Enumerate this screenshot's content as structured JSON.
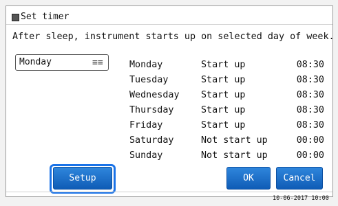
{
  "window": {
    "title": "Set timer",
    "icon": "timer-window-icon"
  },
  "instructions": "After sleep, instrument starts up on selected day of week.",
  "day_select": {
    "value": "Monday",
    "icon": "menu-lines-icon",
    "icon_glyph": "≡≡"
  },
  "schedule": [
    {
      "day": "Monday",
      "status": "Start up",
      "time": "08:30"
    },
    {
      "day": "Tuesday",
      "status": "Start up",
      "time": "08:30"
    },
    {
      "day": "Wednesday",
      "status": "Start up",
      "time": "08:30"
    },
    {
      "day": "Thursday",
      "status": "Start up",
      "time": "08:30"
    },
    {
      "day": "Friday",
      "status": "Start up",
      "time": "08:30"
    },
    {
      "day": "Saturday",
      "status": "Not start up",
      "time": "00:00"
    },
    {
      "day": "Sunday",
      "status": "Not start up",
      "time": "00:00"
    }
  ],
  "buttons": {
    "setup": "Setup",
    "ok": "OK",
    "cancel": "Cancel"
  },
  "status_bar": {
    "timestamp": "10-06-2017 10:00"
  },
  "colors": {
    "button": "#1a6fc9",
    "focus_ring": "#1a73e8",
    "background": "#ffffff"
  }
}
